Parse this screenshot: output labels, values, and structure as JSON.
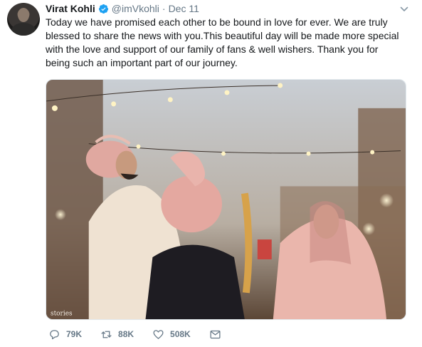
{
  "tweet": {
    "author_name": "Virat Kohli",
    "handle": "@imVkohli",
    "separator": "·",
    "date": "Dec 11",
    "text_lines": [
      "Today we have promised each other to be bound in love for ever. We are truly",
      "blessed to share the news with you.This beautiful day will be made more special",
      "with the love and support of our family of fans & well wishers. Thank you for",
      "being such an important part of our journey."
    ],
    "media_watermark": "stories",
    "icons": {
      "verified": "verified-badge-icon",
      "caret": "chevron-down-icon",
      "reply": "reply-icon",
      "retweet": "retweet-icon",
      "like": "heart-icon",
      "message": "envelope-icon"
    },
    "actions": {
      "replies": "79K",
      "retweets": "88K",
      "likes": "508K"
    },
    "colors": {
      "verified_blue": "#1da1f2",
      "secondary_text": "#657786"
    }
  }
}
